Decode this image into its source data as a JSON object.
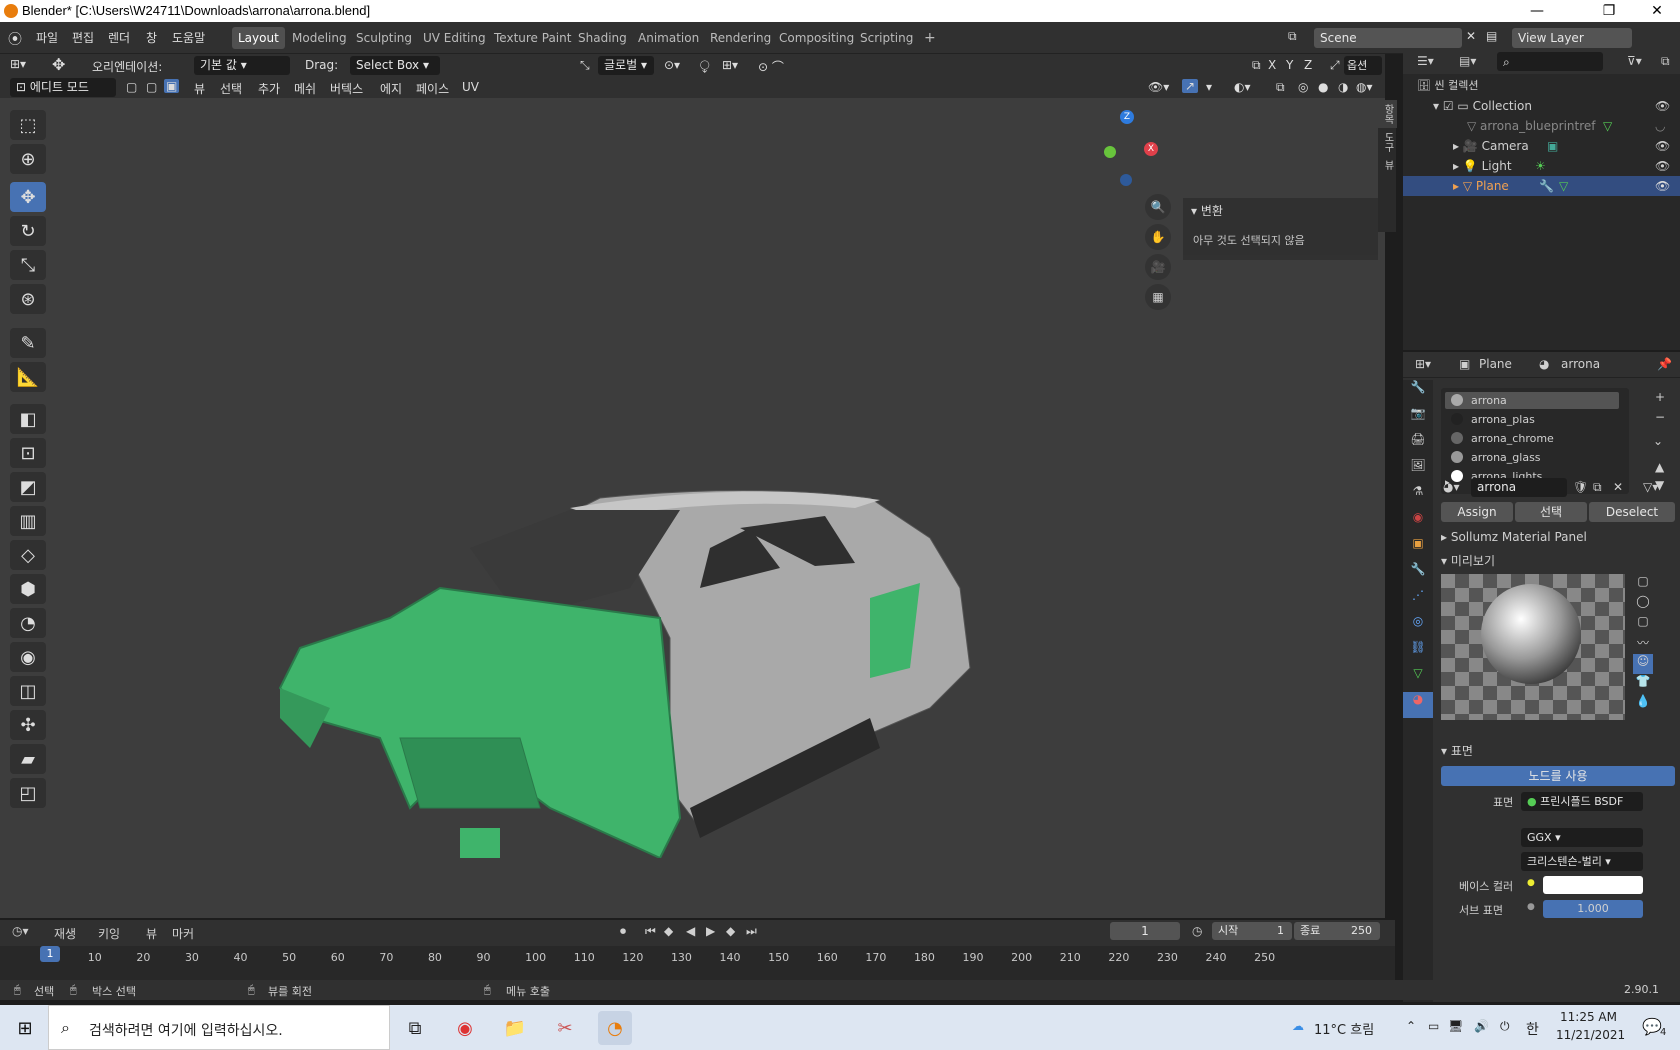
{
  "titlebar": {
    "title": "Blender* [C:\\Users\\W24711\\Downloads\\arrona\\arrona.blend]",
    "min": "—",
    "max": "❐",
    "close": "✕"
  },
  "menu": [
    "파일",
    "편집",
    "렌더",
    "창",
    "도움말"
  ],
  "workspaces": [
    "Layout",
    "Modeling",
    "Sculpting",
    "UV Editing",
    "Texture Paint",
    "Shading",
    "Animation",
    "Rendering",
    "Compositing",
    "Scripting"
  ],
  "active_workspace": "Layout",
  "scene": {
    "name": "Scene",
    "view_layer": "View Layer"
  },
  "vp_header": {
    "orientation_label": "오리엔테이션:",
    "orientation_value": "기본 값",
    "drag_label": "Drag:",
    "drag_value": "Select Box",
    "transform_space": "글로벌",
    "options": "옵션",
    "xyz": [
      "X",
      "Y",
      "Z"
    ]
  },
  "vp_header2": {
    "mode": "에디트 모드",
    "menus": [
      "뷰",
      "선택",
      "추가",
      "메쉬",
      "버텍스",
      "에지",
      "페이스",
      "UV"
    ]
  },
  "npanel": {
    "title": "변환",
    "message": "아무 것도 선택되지 않음"
  },
  "n_tabs": [
    "항목",
    "도구",
    "뷰"
  ],
  "gizmo": {
    "x": "X",
    "y": "Y",
    "z": "Z"
  },
  "outliner": {
    "root": "씬 컬렉션",
    "items": [
      {
        "label": "Collection",
        "color": "#d0d0d0"
      },
      {
        "label": "arrona_blueprintref",
        "color": "#888888"
      },
      {
        "label": "Camera",
        "color": "#d0d0d0"
      },
      {
        "label": "Light",
        "color": "#d0d0d0"
      },
      {
        "label": "Plane",
        "color": "#f0a050"
      }
    ]
  },
  "props": {
    "object": "Plane",
    "material": "arrona",
    "slots": [
      "arrona",
      "arrona_plas",
      "arrona_chrome",
      "arrona_glass",
      "arrona_lights"
    ],
    "mat_field": "arrona",
    "assign": "Assign",
    "select": "선택",
    "deselect": "Deselect",
    "sollumz": "Sollumz Material Panel",
    "preview": "미리보기",
    "surface_section": "표면",
    "use_nodes": "노드를 사용",
    "surface_label": "표면",
    "surface_value": "프린시플드 BSDF",
    "distribution": "GGX",
    "subsurface_method": "크리스텐슨-벌리",
    "base_color_label": "베이스 컬러",
    "subsurface_label": "서브 표면",
    "subsurface_value": "1.000"
  },
  "timeline": {
    "menus": [
      "재생",
      "키잉",
      "뷰",
      "마커"
    ],
    "current_frame": "1",
    "start_label": "시작",
    "start": "1",
    "end_label": "종료",
    "end": "250",
    "ticks": [
      "1",
      "10",
      "20",
      "30",
      "40",
      "50",
      "60",
      "70",
      "80",
      "90",
      "100",
      "110",
      "120",
      "130",
      "140",
      "150",
      "160",
      "170",
      "180",
      "190",
      "200",
      "210",
      "220",
      "230",
      "240",
      "250"
    ]
  },
  "statusbar": {
    "select": "선택",
    "box_select": "박스 선택",
    "rotate_view": "뷰를 회전",
    "call_menu": "메뉴 호출",
    "version": "2.90.1"
  },
  "taskbar": {
    "search_placeholder": "검색하려면 여기에 입력하십시오.",
    "weather": "11°C 흐림",
    "time": "11:25 AM",
    "date": "11/21/2021",
    "ime": "한",
    "notif": "4"
  },
  "colors": {
    "accent": "#4772b3",
    "selected_mesh": "#3fb46b",
    "mesh_gray": "#a9a9a9"
  }
}
